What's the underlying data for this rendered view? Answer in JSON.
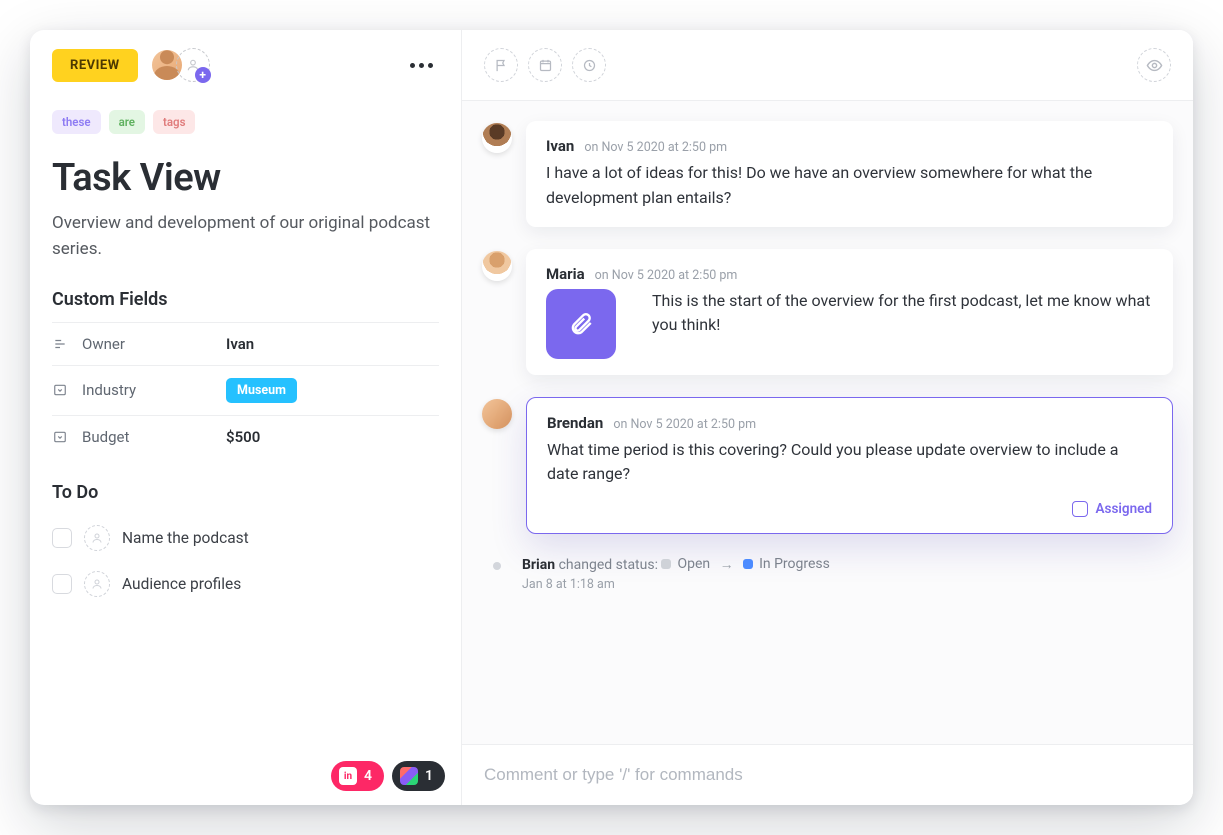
{
  "header": {
    "status_label": "REVIEW"
  },
  "tags": [
    "these",
    "are",
    "tags"
  ],
  "title": "Task View",
  "description": "Overview and development of our original podcast series.",
  "custom_fields": {
    "heading": "Custom Fields",
    "rows": [
      {
        "label": "Owner",
        "value": "Ivan",
        "icon": "text"
      },
      {
        "label": "Industry",
        "value": "Museum",
        "icon": "dropdown",
        "badge": true
      },
      {
        "label": "Budget",
        "value": "$500",
        "icon": "dropdown"
      }
    ]
  },
  "todo": {
    "heading": "To Do",
    "items": [
      {
        "text": "Name the podcast"
      },
      {
        "text": "Audience profiles"
      }
    ]
  },
  "attachments": {
    "invision_count": "4",
    "figma_count": "1"
  },
  "activity": {
    "comments": [
      {
        "author": "Ivan",
        "time": "on Nov 5 2020 at 2:50 pm",
        "body": "I have a lot of ideas for this! Do we have an overview somewhere for what the development plan entails?",
        "has_attachment": false,
        "highlighted": false
      },
      {
        "author": "Maria",
        "time": "on Nov 5 2020 at 2:50 pm",
        "body": "This is the start of the overview for the first podcast, let me know what you think!",
        "has_attachment": true,
        "highlighted": false
      },
      {
        "author": "Brendan",
        "time": "on Nov 5 2020 at 2:50 pm",
        "body": "What time period is this covering? Could you please update overview to include a date range?",
        "has_attachment": false,
        "highlighted": true,
        "assigned_label": "Assigned"
      }
    ],
    "event": {
      "actor": "Brian",
      "verb": "changed status:",
      "from": "Open",
      "to": "In Progress",
      "time": "Jan 8 at 1:18 am"
    }
  },
  "composer": {
    "placeholder": "Comment or type '/' for commands"
  }
}
